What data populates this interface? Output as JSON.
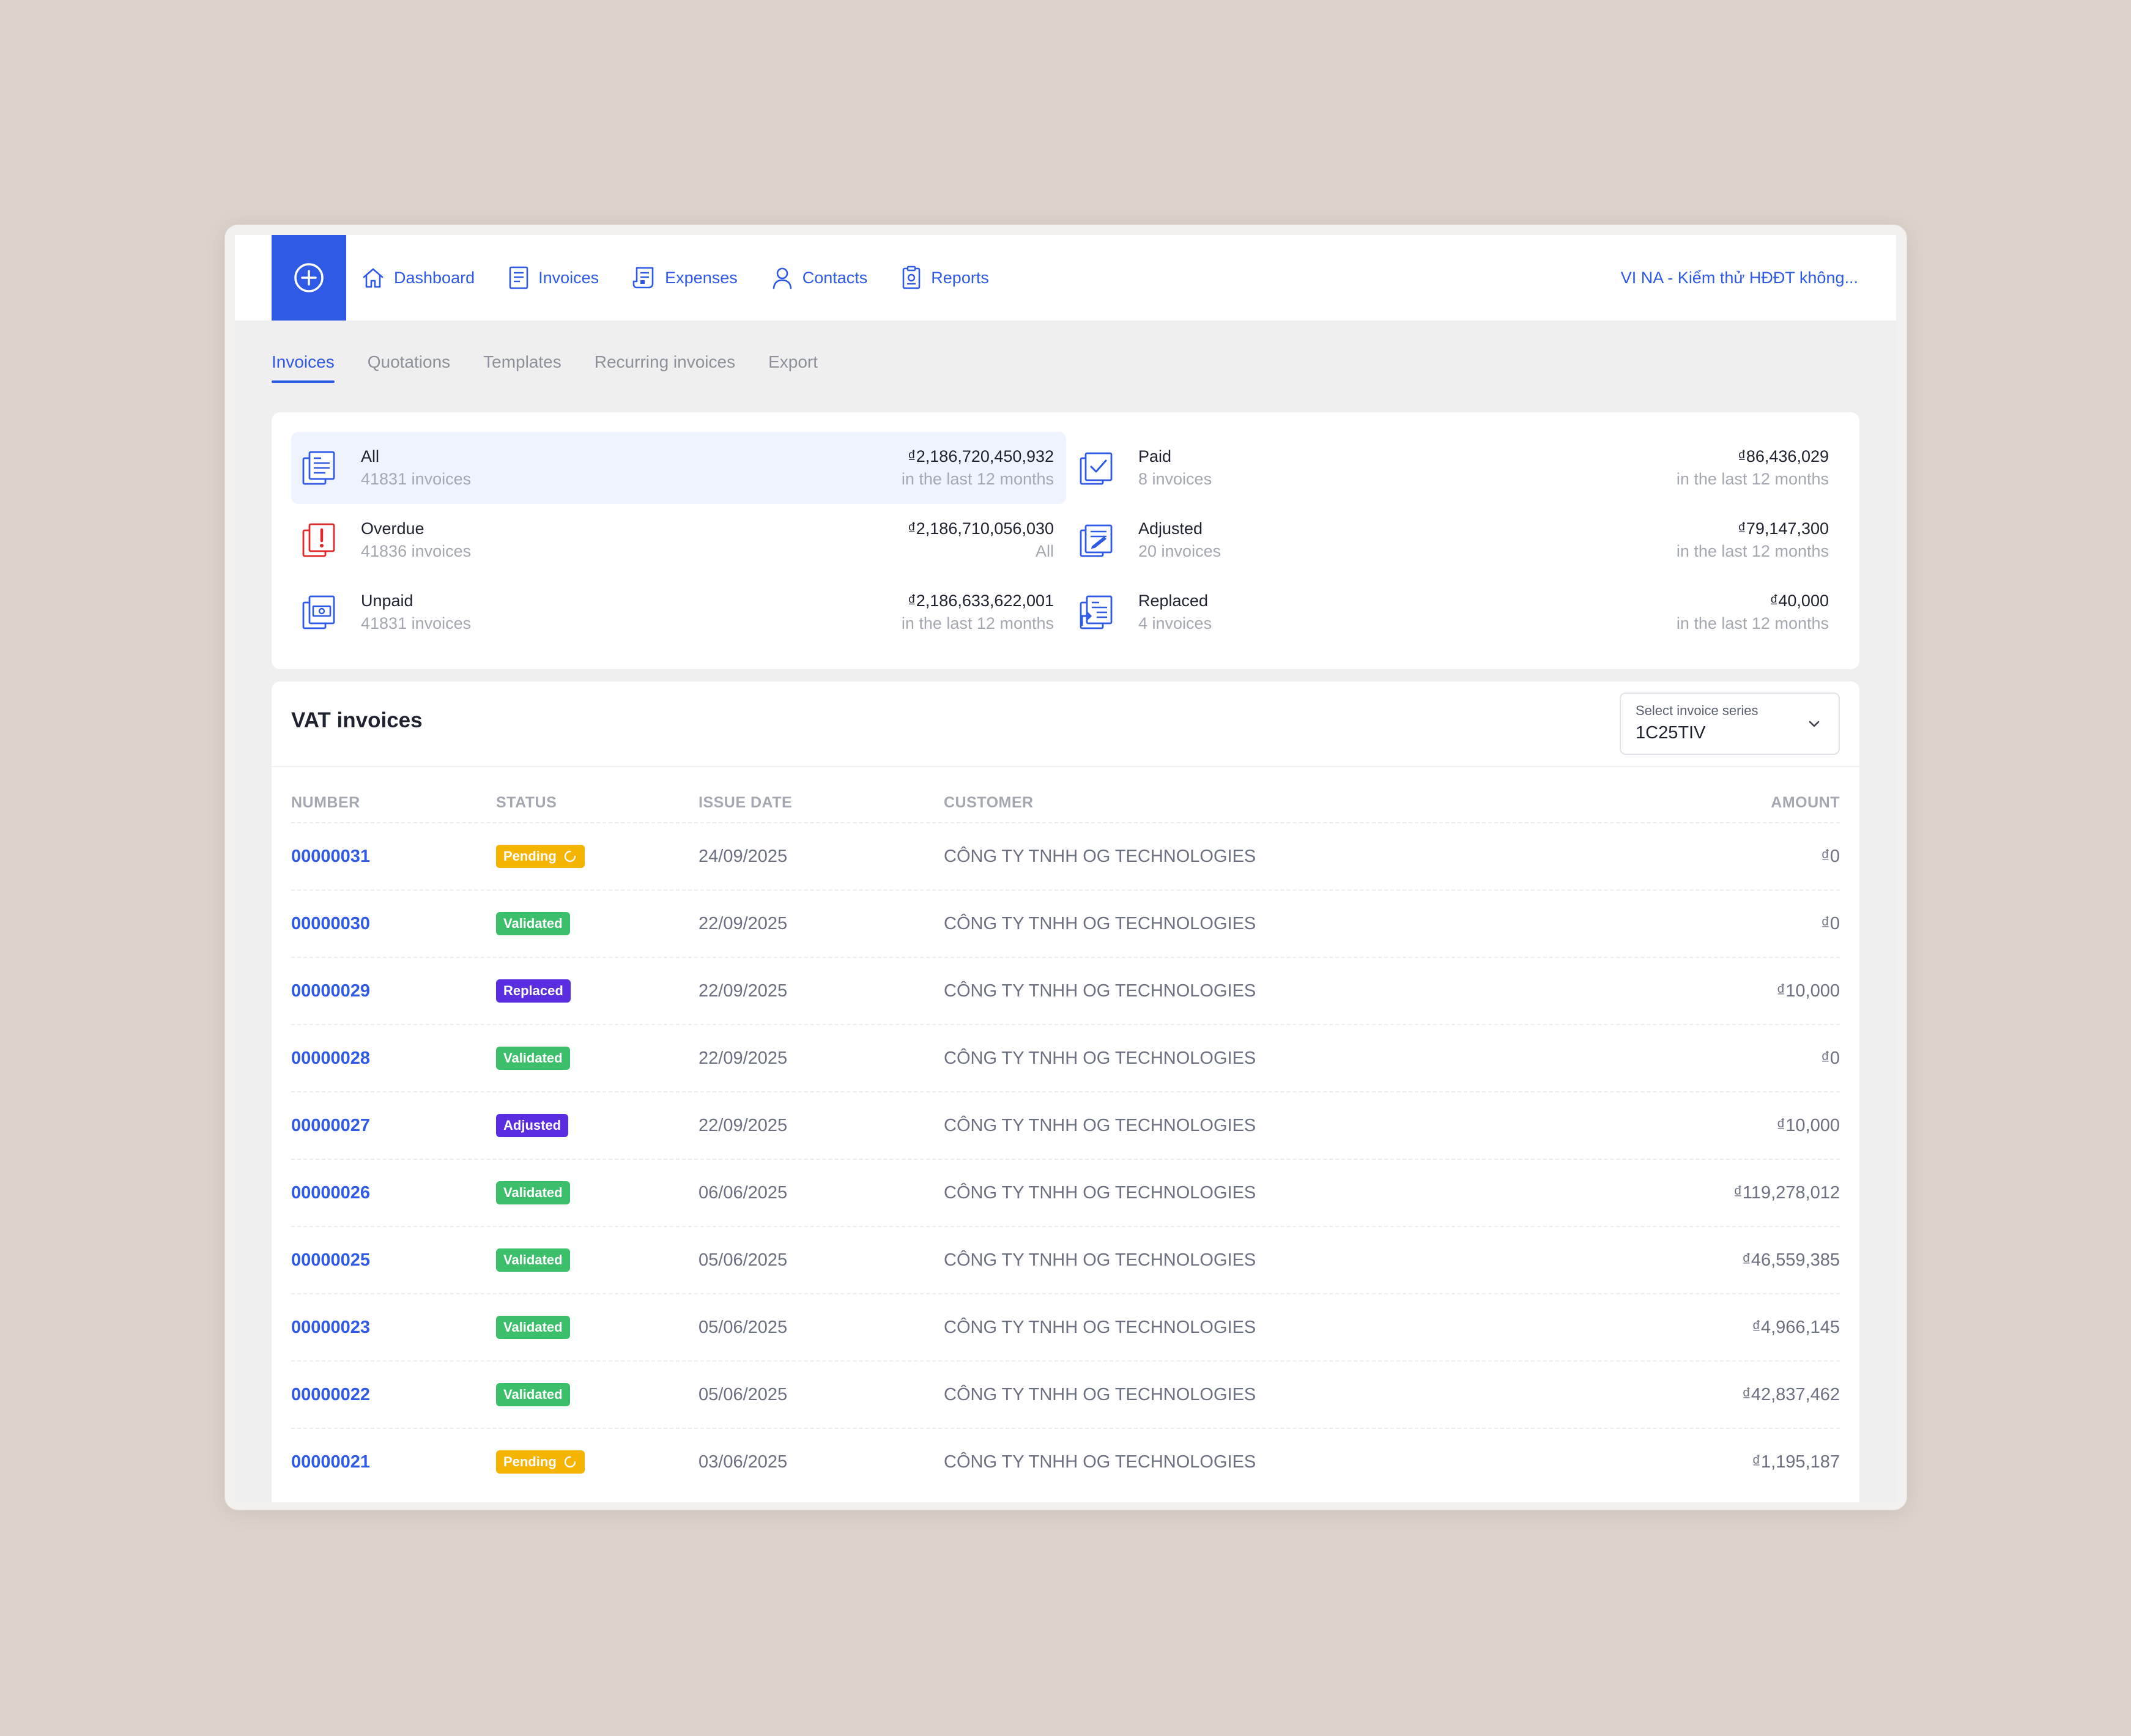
{
  "nav": {
    "items": [
      {
        "label": "Dashboard",
        "icon": "home-icon"
      },
      {
        "label": "Invoices",
        "icon": "invoice-doc-icon"
      },
      {
        "label": "Expenses",
        "icon": "receipt-icon"
      },
      {
        "label": "Contacts",
        "icon": "user-icon"
      },
      {
        "label": "Reports",
        "icon": "report-icon"
      }
    ],
    "company": "VI NA - Kiểm thử HĐĐT không..."
  },
  "tabs": [
    "Invoices",
    "Quotations",
    "Templates",
    "Recurring invoices",
    "Export"
  ],
  "summary": {
    "all": {
      "label": "All",
      "count": "41831 invoices",
      "amount": "₫2,186,720,450,932",
      "period": "in the last 12 months"
    },
    "paid": {
      "label": "Paid",
      "count": "8 invoices",
      "amount": "₫86,436,029",
      "period": "in the last 12 months"
    },
    "overdue": {
      "label": "Overdue",
      "count": "41836 invoices",
      "amount": "₫2,186,710,056,030",
      "period": "All"
    },
    "adjusted": {
      "label": "Adjusted",
      "count": "20 invoices",
      "amount": "₫79,147,300",
      "period": "in the last 12 months"
    },
    "unpaid": {
      "label": "Unpaid",
      "count": "41831 invoices",
      "amount": "₫2,186,633,622,001",
      "period": "in the last 12 months"
    },
    "replaced": {
      "label": "Replaced",
      "count": "4 invoices",
      "amount": "₫40,000",
      "period": "in the last 12 months"
    }
  },
  "table": {
    "title": "VAT invoices",
    "series": {
      "label": "Select invoice series",
      "value": "1C25TIV"
    },
    "headers": {
      "number": "NUMBER",
      "status": "STATUS",
      "date": "ISSUE DATE",
      "customer": "CUSTOMER",
      "amount": "AMOUNT"
    },
    "rows": [
      {
        "number": "00000031",
        "status": "Pending",
        "date": "24/09/2025",
        "customer": "CÔNG TY TNHH OG TECHNOLOGIES",
        "amount": "₫0"
      },
      {
        "number": "00000030",
        "status": "Validated",
        "date": "22/09/2025",
        "customer": "CÔNG TY TNHH OG TECHNOLOGIES",
        "amount": "₫0"
      },
      {
        "number": "00000029",
        "status": "Replaced",
        "date": "22/09/2025",
        "customer": "CÔNG TY TNHH OG TECHNOLOGIES",
        "amount": "₫10,000"
      },
      {
        "number": "00000028",
        "status": "Validated",
        "date": "22/09/2025",
        "customer": "CÔNG TY TNHH OG TECHNOLOGIES",
        "amount": "₫0"
      },
      {
        "number": "00000027",
        "status": "Adjusted",
        "date": "22/09/2025",
        "customer": "CÔNG TY TNHH OG TECHNOLOGIES",
        "amount": "₫10,000"
      },
      {
        "number": "00000026",
        "status": "Validated",
        "date": "06/06/2025",
        "customer": "CÔNG TY TNHH OG TECHNOLOGIES",
        "amount": "₫119,278,012"
      },
      {
        "number": "00000025",
        "status": "Validated",
        "date": "05/06/2025",
        "customer": "CÔNG TY TNHH OG TECHNOLOGIES",
        "amount": "₫46,559,385"
      },
      {
        "number": "00000023",
        "status": "Validated",
        "date": "05/06/2025",
        "customer": "CÔNG TY TNHH OG TECHNOLOGIES",
        "amount": "₫4,966,145"
      },
      {
        "number": "00000022",
        "status": "Validated",
        "date": "05/06/2025",
        "customer": "CÔNG TY TNHH OG TECHNOLOGIES",
        "amount": "₫42,837,462"
      },
      {
        "number": "00000021",
        "status": "Pending",
        "date": "03/06/2025",
        "customer": "CÔNG TY TNHH OG TECHNOLOGIES",
        "amount": "₫1,195,187"
      }
    ]
  },
  "colors": {
    "accent": "#2f5ae6",
    "pending": "#f5b400",
    "validated": "#3cbf6a",
    "replaced": "#5a2ee0",
    "adjusted": "#5a2ee0",
    "overdue": "#e02828"
  }
}
